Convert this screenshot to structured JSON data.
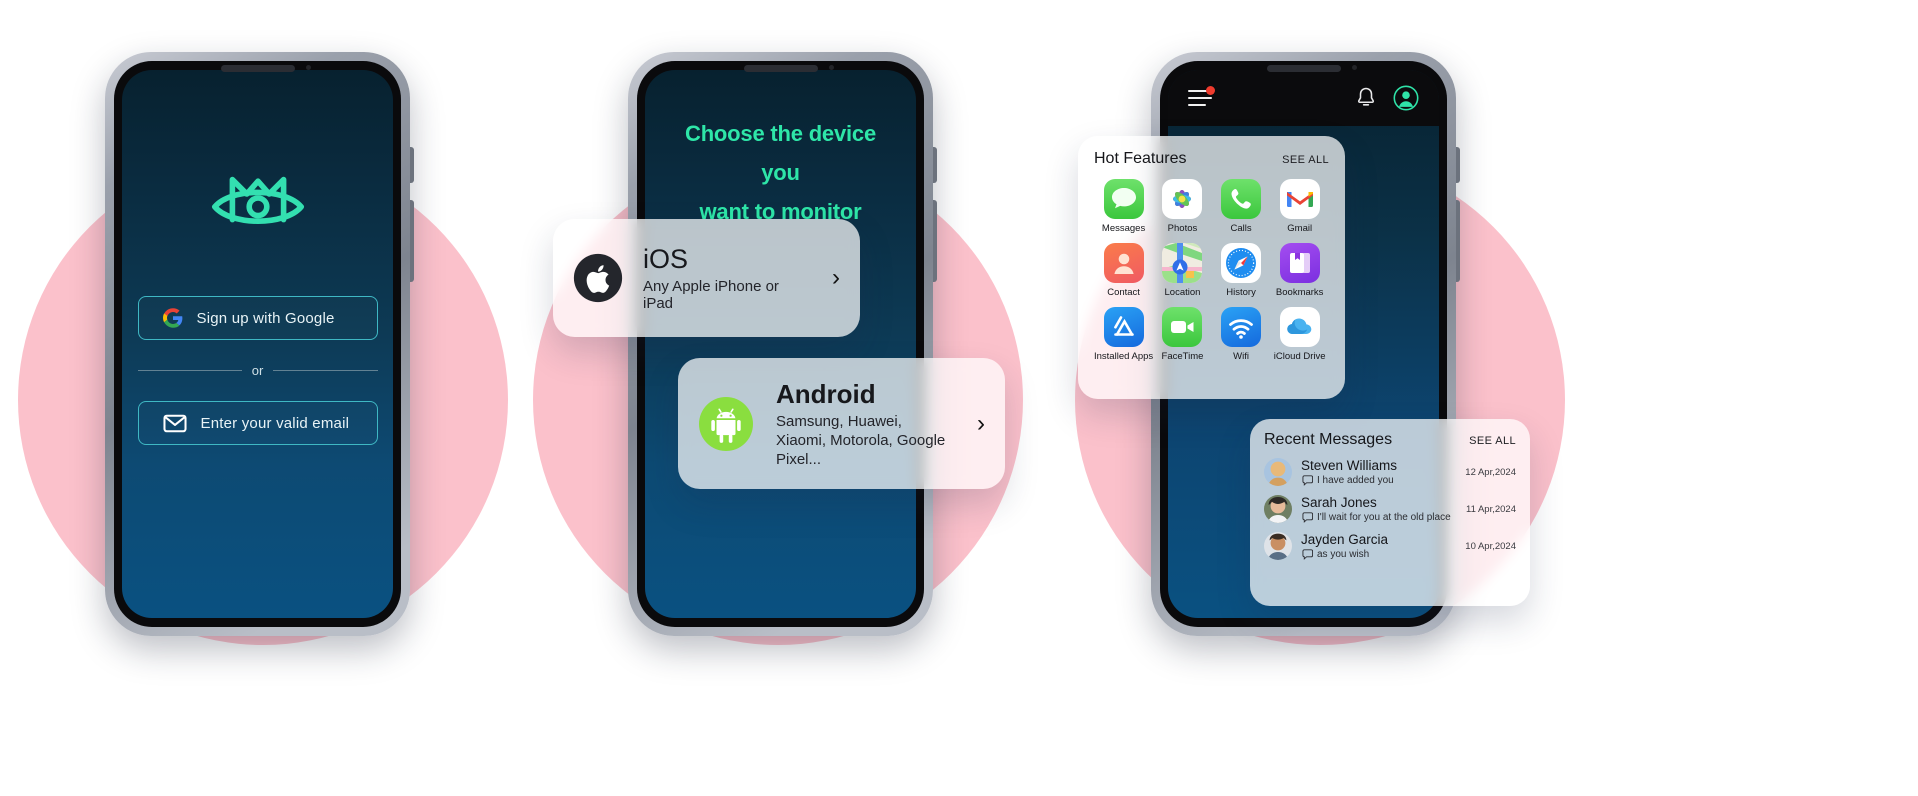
{
  "brand": {
    "logo_name": "m-eye-logo",
    "accent_teal": "#33dfb0",
    "accent_green": "#2ee6a8",
    "pink_circle": "#FBC1CB",
    "screen_top": "#07212f",
    "screen_bottom": "#0a5181"
  },
  "phone1": {
    "name": "signup-screen",
    "google_button_label": "Sign up  with Google",
    "divider_label": "or",
    "email_placeholder": "Enter your valid email",
    "email_value": "",
    "icons": {
      "google": "google-icon",
      "mail": "mail-icon"
    }
  },
  "phone2": {
    "name": "choose-device-screen",
    "title_line1": "Choose the device you",
    "title_line2": "want to monitor",
    "cards": [
      {
        "id": "ios",
        "title": "iOS",
        "subtitle": "Any Apple iPhone or iPad",
        "icon": "apple-icon",
        "chevron": "›"
      },
      {
        "id": "android",
        "title": "Android",
        "subtitle": "Samsung, Huawei, Xiaomi, Motorola, Google Pixel...",
        "icon": "android-icon",
        "chevron": "›"
      }
    ]
  },
  "phone3": {
    "name": "dashboard-screen",
    "topbar": {
      "menu_icon": "hamburger-icon",
      "menu_badge": true,
      "bell_icon": "bell-icon",
      "avatar_icon": "user-avatar-icon"
    },
    "hot_features": {
      "title": "Hot Features",
      "see_all": "SEE ALL",
      "apps": [
        {
          "label": "Messages",
          "icon": "messages-icon"
        },
        {
          "label": "Photos",
          "icon": "photos-icon"
        },
        {
          "label": "Calls",
          "icon": "phone-icon"
        },
        {
          "label": "Gmail",
          "icon": "gmail-icon"
        },
        {
          "label": "Contact",
          "icon": "contact-icon"
        },
        {
          "label": "Location",
          "icon": "maps-icon"
        },
        {
          "label": "History",
          "icon": "safari-icon"
        },
        {
          "label": "Bookmarks",
          "icon": "bookmarks-icon"
        },
        {
          "label": "Installed Apps",
          "icon": "app-store-icon"
        },
        {
          "label": "FaceTime",
          "icon": "facetime-icon"
        },
        {
          "label": "Wifi",
          "icon": "wifi-icon"
        },
        {
          "label": "iCloud Drive",
          "icon": "icloud-icon"
        }
      ]
    },
    "recent_messages": {
      "title": "Recent Messages",
      "see_all": "SEE ALL",
      "items": [
        {
          "name": "Steven Williams",
          "preview": "I have added you",
          "date": "12 Apr,2024",
          "avatar": "avatar-steven"
        },
        {
          "name": "Sarah Jones",
          "preview": "I'll wait for you at the old place",
          "date": "11 Apr,2024",
          "avatar": "avatar-sarah"
        },
        {
          "name": "Jayden Garcia",
          "preview": "as you wish",
          "date": "10 Apr,2024",
          "avatar": "avatar-jayden"
        }
      ]
    }
  }
}
